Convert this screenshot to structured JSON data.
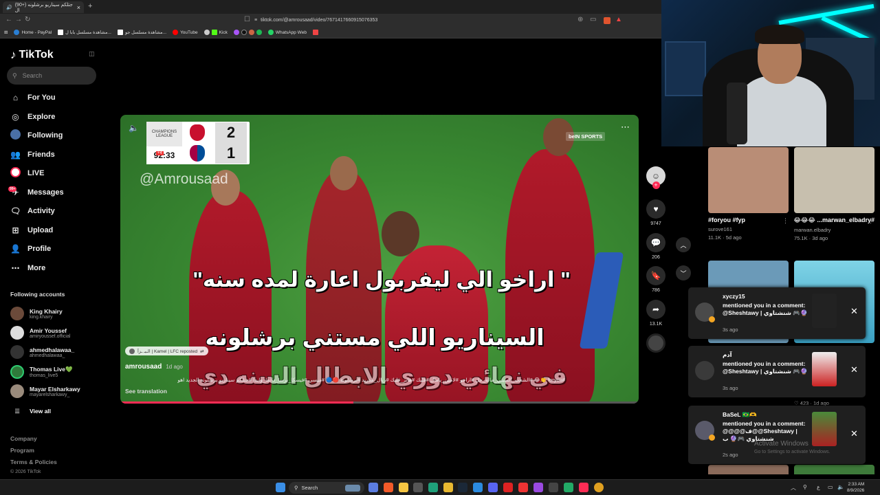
{
  "browser": {
    "tab_title": "‎(90+) جتلكم سيناريو برشلونه ال",
    "new_tab_glyph": "+",
    "url": "tiktok.com/@amrousaad/video/7671417660915076353",
    "bookmarks": [
      "Home - PayPal",
      "مشاهدة مسلسل بابا ل...",
      "مشاهدة مسلسل جو...",
      "YouTube",
      "Kick",
      "WhatsApp Web"
    ]
  },
  "sidebar": {
    "brand": "TikTok",
    "search_placeholder": "Search",
    "nav": [
      {
        "label": "For You",
        "icon": "home-icon"
      },
      {
        "label": "Explore",
        "icon": "compass-icon"
      },
      {
        "label": "Following",
        "icon": "following-avatar-icon"
      },
      {
        "label": "Friends",
        "icon": "friends-icon"
      },
      {
        "label": "LIVE",
        "icon": "live-icon"
      },
      {
        "label": "Messages",
        "icon": "messages-icon",
        "badge": "99+"
      },
      {
        "label": "Activity",
        "icon": "activity-icon"
      },
      {
        "label": "Upload",
        "icon": "upload-icon"
      },
      {
        "label": "Profile",
        "icon": "profile-icon"
      },
      {
        "label": "More",
        "icon": "more-icon"
      }
    ],
    "following_title": "Following accounts",
    "accounts": [
      {
        "name": "King Khairy",
        "handle": "king.khairy"
      },
      {
        "name": "Amir Youssef",
        "handle": "amiryoussef.official"
      },
      {
        "name": "ahmedhalawaa_",
        "handle": "ahmedhalawaa_"
      },
      {
        "name": "Thomas Live💚",
        "handle": "thomas_live5"
      },
      {
        "name": "Mayar Elsharkawy",
        "handle": "mayarelsharkawy_"
      }
    ],
    "view_all": "View all",
    "footer": [
      "Company",
      "Program",
      "Terms & Policies",
      "© 2026 TikTok"
    ]
  },
  "video": {
    "competition": "CHAMPIONS LEAGUE",
    "match_time": "92:33",
    "added_time": "+4",
    "score_top": "2",
    "score_bottom": "1",
    "watermark": "@Amrousaad",
    "broadcaster": "beIN SPORTS",
    "caption_line1": "\" اراخو الي ليفربول اعارة لمده سنه\"",
    "caption_line2": "السيناريو اللي مستني برشلونه",
    "caption_line3": "في نهائي دوري الابطال السنه دي",
    "repost": "الـبـ ـزآ  | Kamel | LFC reposted",
    "author": "amrousaad",
    "posted": "1d ago",
    "description": "#foryou 👏😂 #الشعب_الصيني_ماله_حل #اراخو #لامين_يامال #فليك #هانز_فليك #ريال_مدريد #برشلونة 🔴🔵 #ميسي #فيسكا_برسا_دائما_وابدا #جتلكم سيناريو برشلونه الجديد اهو",
    "see_translation": "See translation",
    "progress": 0.45
  },
  "actions": {
    "likes": "9747",
    "comments": "206",
    "saves": "786",
    "shares": "13.1K"
  },
  "feed": [
    {
      "title": "#foryou #fyp",
      "user": "surove161",
      "stats": "11.1K · 5d ago",
      "color": "#b98d76"
    },
    {
      "title": "#marwan_elbadry... 😂😂😂😂😂 أنا أسف",
      "user": "marwan.elbadry",
      "stats": "75.1K · 3d ago",
      "color": "#c7bfae"
    }
  ],
  "notifications": [
    {
      "user": "xyczy15",
      "text": "mentioned you in a comment: @Sheshtawy | شنشتاوي 🎮🔮",
      "time": "3s ago"
    },
    {
      "user": "آدم",
      "text": "mentioned you in a comment: @Sheshtawy | شنشتاوي 🎮🔮",
      "time": "3s ago"
    },
    {
      "user": "BaSeL 🇧🇷🫶",
      "text": "mentioned you in a comment: @@@@ف@@Sheshtawy | شنشتاوي 🎮🔮 ب",
      "time": "2s ago"
    }
  ],
  "partial_card_stats": "♡ 423 · 1d ago",
  "windows": {
    "activate_title": "Activate Windows",
    "activate_sub": "Go to Settings to activate Windows.",
    "search": "Search",
    "time": "2:33 AM",
    "date": "8/9/2026"
  }
}
